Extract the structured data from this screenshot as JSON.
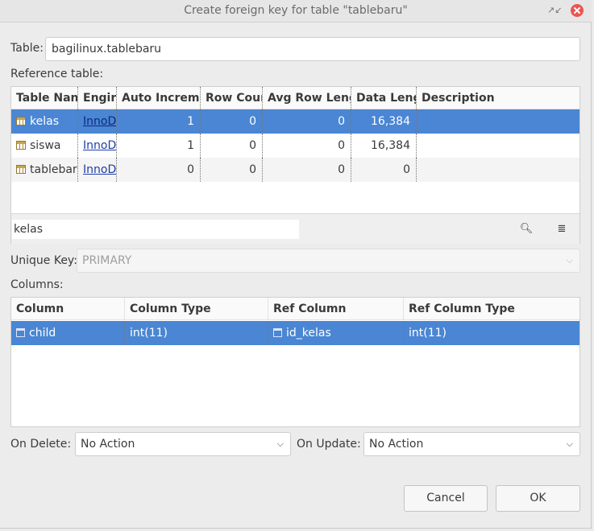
{
  "window": {
    "title": "Create foreign key for table \"tablebaru\""
  },
  "table": {
    "label": "Table:",
    "value": "bagilinux.tablebaru"
  },
  "reference_table": {
    "label": "Reference table:",
    "columns": [
      "Table Nan",
      "Engir",
      "Auto Increme",
      "Row Cour",
      "Avg Row Leng",
      "Data Leng",
      "Description"
    ],
    "rows": [
      {
        "name": "kelas",
        "engine": "InnoD",
        "auto_increment": "1",
        "row_count": "0",
        "avg_row_length": "0",
        "data_length": "16,384",
        "description": "",
        "selected": true
      },
      {
        "name": "siswa",
        "engine": "InnoD",
        "auto_increment": "1",
        "row_count": "0",
        "avg_row_length": "0",
        "data_length": "16,384",
        "description": "",
        "selected": false
      },
      {
        "name": "tablebaru",
        "engine": "InnoD",
        "auto_increment": "0",
        "row_count": "0",
        "avg_row_length": "0",
        "data_length": "0",
        "description": "",
        "selected": false
      }
    ],
    "filter_value": "kelas",
    "filter_icons": [
      "search-icon",
      "filter-settings-icon"
    ]
  },
  "unique_key": {
    "label": "Unique Key:",
    "value": "PRIMARY"
  },
  "columns_section": {
    "label": "Columns:",
    "headers": [
      "Column",
      "Column Type",
      "Ref Column",
      "Ref Column Type"
    ],
    "rows": [
      {
        "column": "child",
        "column_type": "int(11)",
        "ref_column": "id_kelas",
        "ref_column_type": "int(11)"
      }
    ]
  },
  "on_delete": {
    "label": "On Delete:",
    "value": "No Action"
  },
  "on_update": {
    "label": "On Update:",
    "value": "No Action"
  },
  "buttons": {
    "cancel": "Cancel",
    "ok": "OK"
  },
  "colors": {
    "selection": "#4a86d4",
    "close_button": "#ec5454"
  }
}
